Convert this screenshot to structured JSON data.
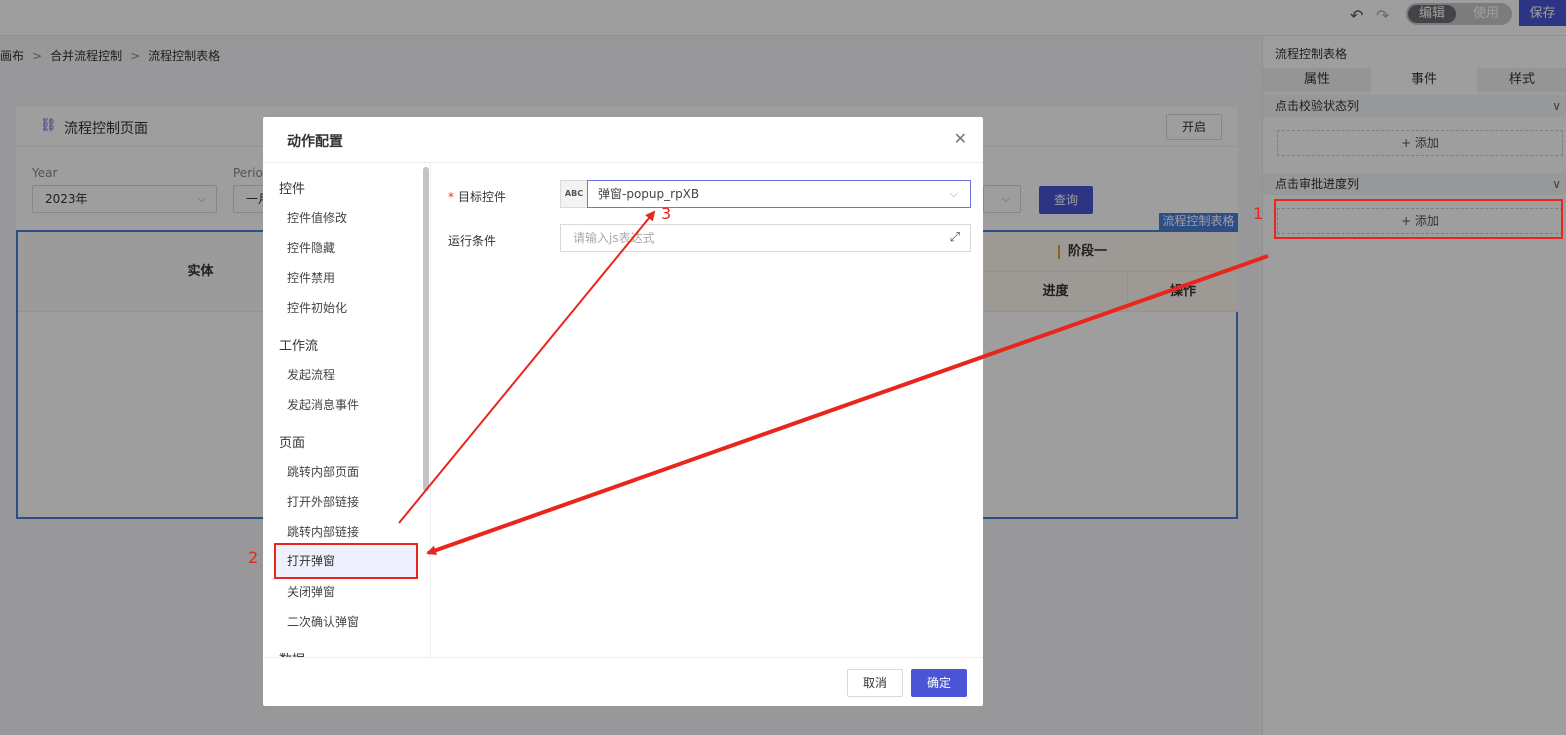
{
  "topbar": {
    "undo_icon": "undo-icon",
    "redo_icon": "redo-icon",
    "mode_edit": "编辑",
    "mode_use": "使用",
    "save_label": "保存"
  },
  "breadcrumb": [
    "画布",
    "合并流程控制",
    "流程控制表格"
  ],
  "card": {
    "title": "流程控制页面",
    "open_label": "开启",
    "filters": [
      {
        "label": "Year",
        "value": "2023年"
      },
      {
        "label": "Perio",
        "value": "一月"
      }
    ],
    "query_label": "查询",
    "table_tag": "流程控制表格",
    "table": {
      "entity_header": "实体",
      "stage_header": "阶段一",
      "progress_header": "进度",
      "operation_header": "操作"
    }
  },
  "right_panel": {
    "title": "流程控制表格",
    "tabs": [
      {
        "label": "属性",
        "active": false
      },
      {
        "label": "事件",
        "active": true
      },
      {
        "label": "样式",
        "active": false
      }
    ],
    "sections": [
      {
        "label": "点击校验状态列",
        "add_label": "+ 添加"
      },
      {
        "label": "点击审批进度列",
        "add_label": "+ 添加"
      }
    ]
  },
  "modal": {
    "title": "动作配置",
    "groups": [
      {
        "label": "控件",
        "items": [
          "控件值修改",
          "控件隐藏",
          "控件禁用",
          "控件初始化"
        ]
      },
      {
        "label": "工作流",
        "items": [
          "发起流程",
          "发起消息事件"
        ]
      },
      {
        "label": "页面",
        "items": [
          "跳转内部页面",
          "打开外部链接",
          "跳转内部链接",
          "打开弹窗",
          "关闭弹窗",
          "二次确认弹窗"
        ]
      },
      {
        "label": "数据",
        "items": []
      }
    ],
    "selected_item": "打开弹窗",
    "target_label": "目标控件",
    "target_required": "*",
    "target_type_badge": "ABC",
    "target_value": "弹窗-popup_rpXB",
    "condition_label": "运行条件",
    "condition_placeholder": "请输入js表达式",
    "cancel_label": "取消",
    "ok_label": "确定"
  },
  "annotations": [
    "1",
    "2",
    "3"
  ],
  "colors": {
    "primary": "#4a55d6",
    "annotation": "#e8261d",
    "table_border": "#4a7cd9"
  }
}
